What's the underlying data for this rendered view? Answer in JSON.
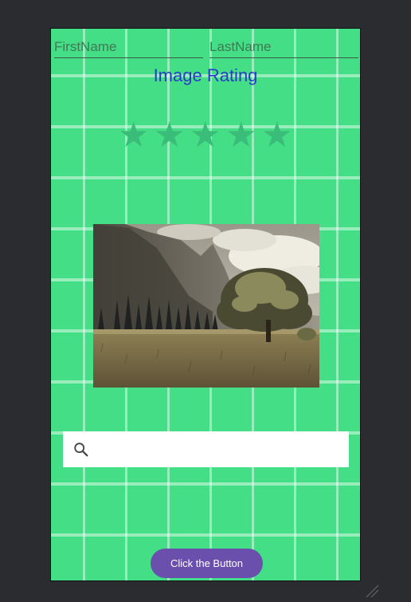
{
  "form": {
    "first_name_placeholder": "FirstName",
    "last_name_placeholder": "LastName"
  },
  "title": "Image Rating",
  "rating": {
    "value": 0,
    "max": 5,
    "star_glyph": "★"
  },
  "image": {
    "icon": "landscape-photo"
  },
  "search": {
    "icon": "search-icon",
    "value": ""
  },
  "button": {
    "label": "Click the Button"
  },
  "colors": {
    "background": "#43de86",
    "title": "#2a3cc6",
    "button": "#6a4fad",
    "star_empty": "#3bbd7a"
  }
}
